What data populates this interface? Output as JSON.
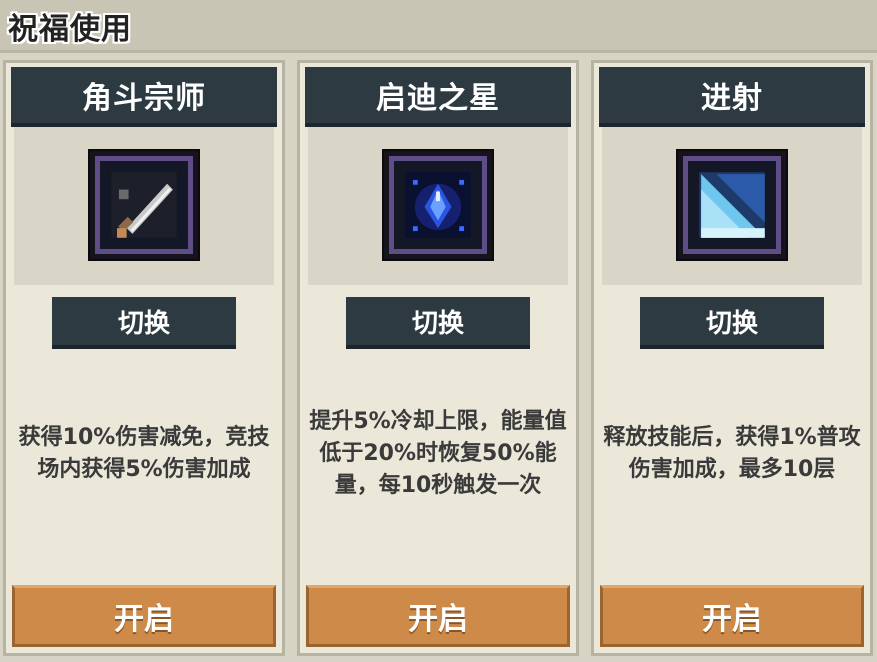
{
  "header": {
    "title": "祝福使用"
  },
  "cards": [
    {
      "name": "角斗宗师",
      "icon": "sword-icon",
      "switch_label": "切换",
      "description": "获得10%伤害减免，竞技场内获得5%伤害加成",
      "open_label": "开启"
    },
    {
      "name": "启迪之星",
      "icon": "star-crystal-icon",
      "switch_label": "切换",
      "description": "提升5%冷却上限，能量值低于20%时恢复50%能量，每10秒触发一次",
      "open_label": "开启"
    },
    {
      "name": "进射",
      "icon": "ice-slash-icon",
      "switch_label": "切换",
      "description": "释放技能后，获得1%普攻伤害加成，最多10层",
      "open_label": "开启"
    }
  ],
  "colors": {
    "header_dark": "#2d3a42",
    "button_orange": "#cd8a48",
    "frame_purple": "#5e4d86",
    "background": "#d7d4c6"
  }
}
